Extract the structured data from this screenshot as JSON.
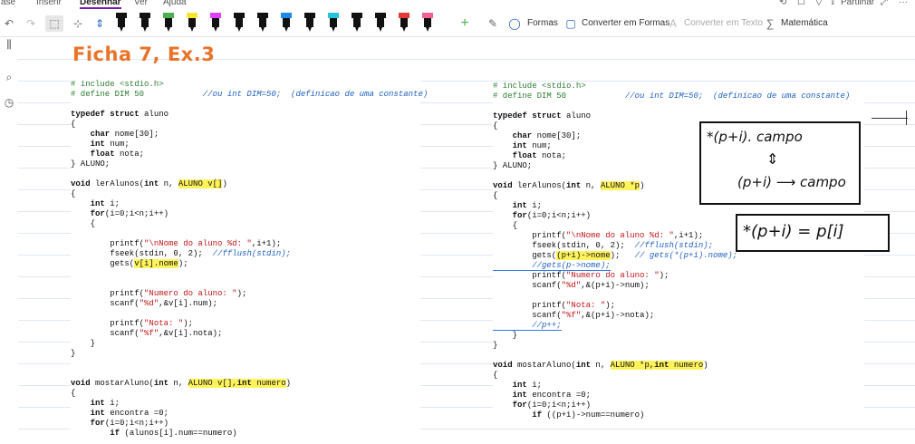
{
  "ribbon": {
    "tabs": [
      "ase",
      "Inserir",
      "Desenhar",
      "Ver",
      "Ajuda"
    ],
    "active_tab": "Desenhar",
    "share_label": "Partilhar",
    "more_label": "···"
  },
  "toolbar": {
    "undo_icon": "undo-icon",
    "redo_icon": "redo-icon",
    "pens": [
      {
        "color": "#111111"
      },
      {
        "color": "#111111"
      },
      {
        "color": "#4caf50"
      },
      {
        "color": "#f5e636"
      },
      {
        "color": "#e040fb"
      },
      {
        "color": "#111111"
      },
      {
        "color": "#111111"
      },
      {
        "color": "#1e88e5"
      },
      {
        "color": "#111111"
      },
      {
        "color": "#26c6da"
      },
      {
        "color": "#111111"
      },
      {
        "color": "#111111"
      },
      {
        "color": "#e53935"
      },
      {
        "color": "#f06292"
      }
    ],
    "add_pen": "+",
    "shapes_label": "Formas",
    "convert_shapes_label": "Converter em Formas",
    "convert_text_label": "Converter em Texto",
    "math_label": "Matemática"
  },
  "page": {
    "title": "Ficha 7, Ex.3",
    "left_code": [
      "# include <stdio.h>",
      "# define DIM 50            //ou int DIM=50;  (definicao de uma constante)",
      "",
      "typedef struct aluno",
      "{",
      "    char nome[30];",
      "    int num;",
      "    float nota;",
      "} ALUNO;",
      "",
      "void lerAlunos(int n, ALUNO v[])",
      "{",
      "    int i;",
      "    for(i=0;i<n;i++)",
      "    {",
      "",
      "        printf(\"\\nNome do aluno %d: \",i+1);",
      "        fseek(stdin, 0, 2);  //fflush(stdin);",
      "        gets(v[i].nome);",
      "",
      "",
      "        printf(\"Numero do aluno: \");",
      "        scanf(\"%d\",&v[i].num);",
      "",
      "        printf(\"Nota: \");",
      "        scanf(\"%f\",&v[i].nota);",
      "    }",
      "}",
      "",
      "",
      "void mostarAluno(int n, ALUNO v[],int numero)",
      "{",
      "    int i;",
      "    int encontra =0;",
      "    for(i=0;i<n;i++)",
      "        if (alunos[i].num==numero)"
    ],
    "right_code": [
      "# include <stdio.h>",
      "# define DIM 50            //ou int DIM=50;  (definicao de uma constante)",
      "",
      "typedef struct aluno",
      "{",
      "    char nome[30];",
      "    int num;",
      "    float nota;",
      "} ALUNO;",
      "",
      "void lerAlunos(int n, ALUNO *p)",
      "{",
      "    int i;",
      "    for(i=0;i<n;i++)",
      "    {",
      "        printf(\"\\nNome do aluno %d: \",i+1);",
      "        fseek(stdin, 0, 2);  //fflush(stdin);",
      "        gets((p+i)->nome);   // gets(*(p+i).nome);",
      "        //gets(p->nome);",
      "        printf(\"Numero do aluno: \");",
      "        scanf(\"%d\",&(p+i)->num);",
      "",
      "        printf(\"Nota: \");",
      "        scanf(\"%f\",&(p+i)->nota);",
      "        //p++;",
      "    }",
      "}",
      "",
      "void mostarAluno(int n, ALUNO *p,int numero)",
      "{",
      "    int i;",
      "    int encontra =0;",
      "    for(i=0;i<n;i++)",
      "        if ((p+i)->num==numero)"
    ],
    "note1": {
      "line1": "*(p+i). campo",
      "arrow": "⇕",
      "line3": "(p+i) ⟶ campo"
    },
    "note2": {
      "text": "*(p+i) = p[i]"
    }
  }
}
